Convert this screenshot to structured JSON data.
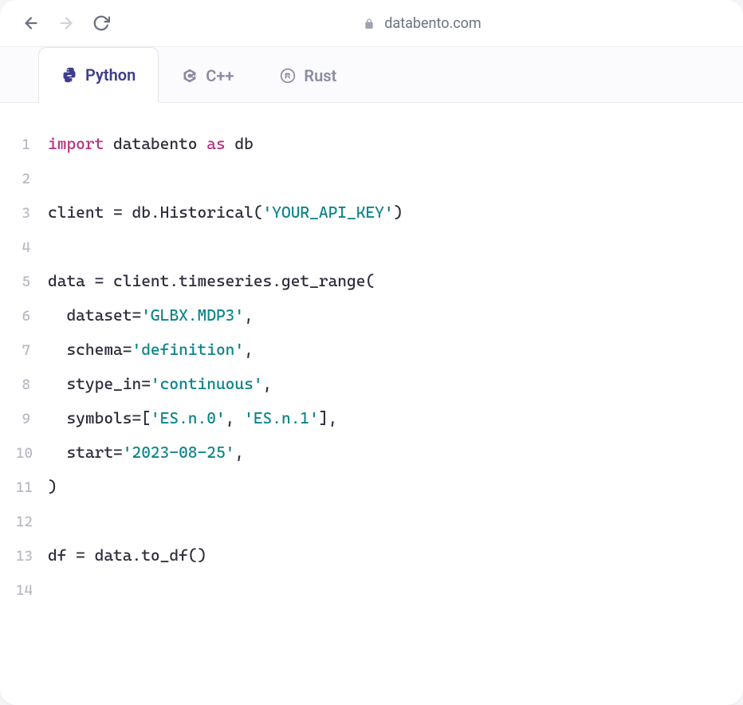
{
  "browser": {
    "url": "databento.com"
  },
  "tabs": [
    {
      "label": "Python",
      "active": true
    },
    {
      "label": "C++",
      "active": false
    },
    {
      "label": "Rust",
      "active": false
    }
  ],
  "code": {
    "lines": [
      {
        "n": "1",
        "tokens": [
          {
            "t": "import ",
            "c": "kw-import"
          },
          {
            "t": "databento ",
            "c": ""
          },
          {
            "t": "as ",
            "c": "kw-as"
          },
          {
            "t": "db",
            "c": ""
          }
        ]
      },
      {
        "n": "2",
        "tokens": []
      },
      {
        "n": "3",
        "tokens": [
          {
            "t": "client = db.Historical(",
            "c": ""
          },
          {
            "t": "'YOUR_API_KEY'",
            "c": "str"
          },
          {
            "t": ")",
            "c": ""
          }
        ]
      },
      {
        "n": "4",
        "tokens": []
      },
      {
        "n": "5",
        "tokens": [
          {
            "t": "data = client.timeseries.get_range(",
            "c": ""
          }
        ]
      },
      {
        "n": "6",
        "tokens": [
          {
            "t": "  dataset=",
            "c": ""
          },
          {
            "t": "'GLBX.MDP3'",
            "c": "str"
          },
          {
            "t": ",",
            "c": ""
          }
        ]
      },
      {
        "n": "7",
        "tokens": [
          {
            "t": "  schema=",
            "c": ""
          },
          {
            "t": "'definition'",
            "c": "str"
          },
          {
            "t": ",",
            "c": ""
          }
        ]
      },
      {
        "n": "8",
        "tokens": [
          {
            "t": "  stype_in=",
            "c": ""
          },
          {
            "t": "'continuous'",
            "c": "str"
          },
          {
            "t": ",",
            "c": ""
          }
        ]
      },
      {
        "n": "9",
        "tokens": [
          {
            "t": "  symbols=[",
            "c": ""
          },
          {
            "t": "'ES.n.0'",
            "c": "str"
          },
          {
            "t": ", ",
            "c": ""
          },
          {
            "t": "'ES.n.1'",
            "c": "str"
          },
          {
            "t": "],",
            "c": ""
          }
        ]
      },
      {
        "n": "10",
        "tokens": [
          {
            "t": "  start=",
            "c": ""
          },
          {
            "t": "'2023-08-25'",
            "c": "str"
          },
          {
            "t": ",",
            "c": ""
          }
        ]
      },
      {
        "n": "11",
        "tokens": [
          {
            "t": ")",
            "c": ""
          }
        ]
      },
      {
        "n": "12",
        "tokens": []
      },
      {
        "n": "13",
        "tokens": [
          {
            "t": "df = data.to_df()",
            "c": ""
          }
        ]
      },
      {
        "n": "14",
        "tokens": []
      }
    ]
  }
}
